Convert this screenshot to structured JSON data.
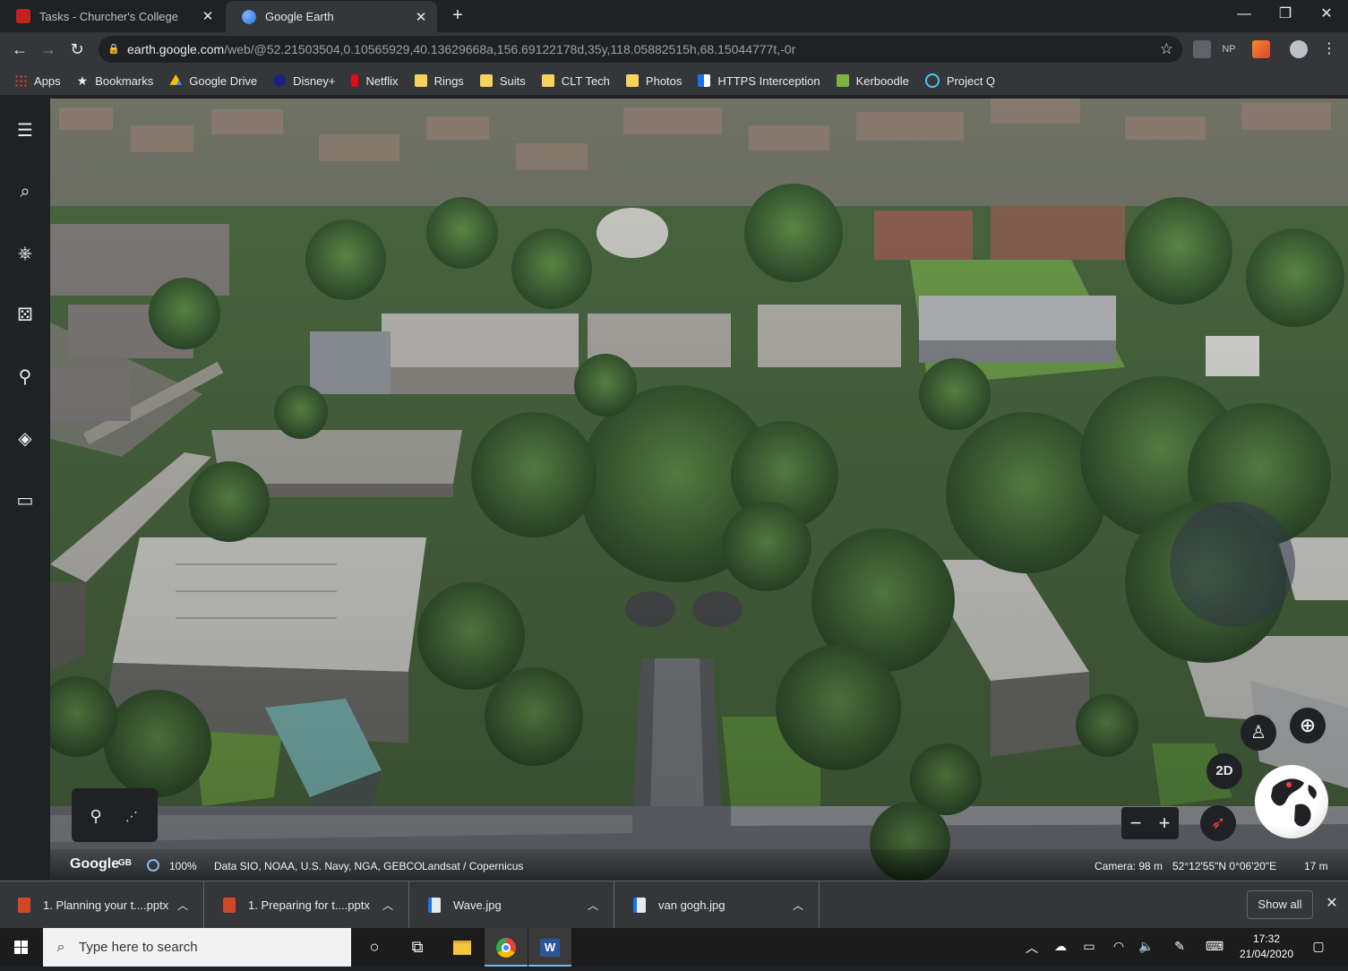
{
  "tabs": [
    {
      "title": "Tasks - Churcher's College",
      "favicon_color": "#c5221f"
    },
    {
      "title": "Google Earth",
      "favicon_color": "#4285f4"
    }
  ],
  "omnibox": {
    "host": "earth.google.com",
    "path": "/web/@52.21503504,0.10565929,40.13629668a,156.69122178d,35y,118.05882515h,68.15044777t,-0r"
  },
  "extensions": [
    "NP"
  ],
  "bookmarks": [
    {
      "label": "Apps",
      "icon": "apps-grid-icon"
    },
    {
      "label": "Bookmarks",
      "icon": "star-icon"
    },
    {
      "label": "Google Drive",
      "icon": "google-drive-icon"
    },
    {
      "label": "Disney+",
      "icon": "disney-icon"
    },
    {
      "label": "Netflix",
      "icon": "netflix-icon"
    },
    {
      "label": "Rings",
      "icon": "folder-icon"
    },
    {
      "label": "Suits",
      "icon": "folder-icon"
    },
    {
      "label": "CLT Tech",
      "icon": "folder-icon"
    },
    {
      "label": "Photos",
      "icon": "folder-icon"
    },
    {
      "label": "HTTPS Interception",
      "icon": "page-icon"
    },
    {
      "label": "Kerboodle",
      "icon": "kerboodle-icon"
    },
    {
      "label": "Project Q",
      "icon": "project-q-icon"
    }
  ],
  "earth": {
    "view_2d_label": "2D",
    "attribution": {
      "logo": "Google",
      "region": "GB",
      "loading_percent": "100%",
      "data_credits": "Data SIO, NOAA, U.S. Navy, NGA, GEBCO",
      "imagery_credits": "Landsat / Copernicus",
      "camera": "Camera: 98 m",
      "coordinates": "52°12'55\"N 0°06'20\"E",
      "scale": "17 m"
    }
  },
  "downloads": [
    {
      "name": "1. Planning your t....pptx",
      "type": "pptx"
    },
    {
      "name": "1. Preparing for t....pptx",
      "type": "pptx"
    },
    {
      "name": "Wave.jpg",
      "type": "jpg"
    },
    {
      "name": "van gogh.jpg",
      "type": "jpg"
    }
  ],
  "downloads_show_all": "Show all",
  "taskbar": {
    "search_placeholder": "Type here to search",
    "time": "17:32",
    "date": "21/04/2020"
  },
  "colors": {
    "chrome_dark": "#202124",
    "chrome_toolbar": "#35363a",
    "accent": "#4285f4"
  }
}
